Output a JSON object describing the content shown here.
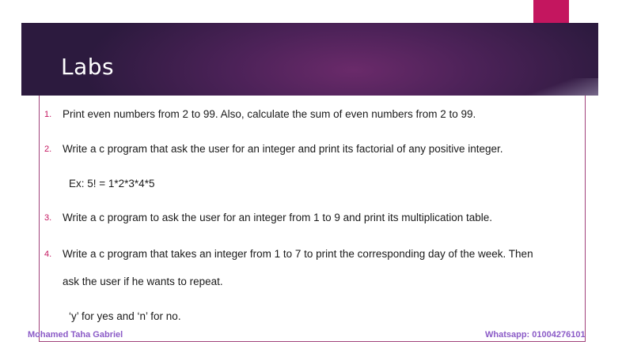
{
  "slide": {
    "title": "Labs"
  },
  "items": [
    {
      "num": "1.",
      "text": "Print even numbers from 2 to 99. Also, calculate the sum of even numbers from 2 to 99."
    },
    {
      "num": "2.",
      "text": "Write a c program that ask the user for an integer and print its factorial of any positive integer."
    },
    {
      "num": "",
      "text": "Ex: 5! = 1*2*3*4*5"
    },
    {
      "num": "3.",
      "text": "Write a c program to ask the user for an integer from 1 to 9 and print its multiplication table."
    },
    {
      "num": "4.",
      "text": "Write a c program that takes an integer from 1 to 7 to print the corresponding day of the week. Then"
    },
    {
      "num": "",
      "text": "ask the user if he wants to repeat."
    },
    {
      "num": "",
      "text": "‘y’ for yes and ‘n’ for no."
    }
  ],
  "footer": {
    "author": "Mohamed Taha Gabriel",
    "contact": "Whatsapp: 01004276101"
  },
  "colors": {
    "accent": "#c4165f",
    "banner": "#4c2258",
    "footer_text": "#8b5bc7"
  }
}
